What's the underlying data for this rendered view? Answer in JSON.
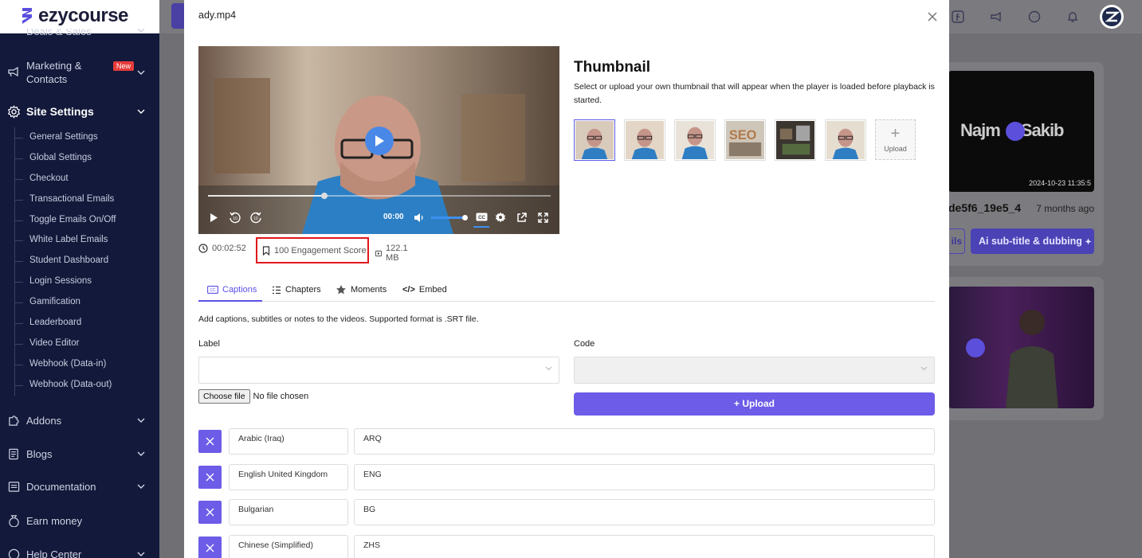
{
  "brand": {
    "name": "ezycourse"
  },
  "sidebar": {
    "partial_top": "Deals & Sales",
    "marketing": {
      "label_line1": "Marketing &",
      "label_line2": "Contacts",
      "badge": "New"
    },
    "site_settings": "Site Settings",
    "sub_items": [
      "General Settings",
      "Global Settings",
      "Checkout",
      "Transactional Emails",
      "Toggle Emails On/Off",
      "White Label Emails",
      "Student Dashboard",
      "Login Sessions",
      "Gamification",
      "Leaderboard",
      "Video Editor",
      "Webhook (Data-in)",
      "Webhook (Data-out)"
    ],
    "addons": "Addons",
    "blogs": "Blogs",
    "documentation": "Documentation",
    "earn_money": "Earn money",
    "help_center": "Help Center"
  },
  "background_cards": {
    "card1": {
      "watermark_left": "Najm",
      "watermark_right": "Sakib",
      "date": "2024-10-23 11:35:5",
      "title": "de5f6_19e5_4",
      "time": "7 months ago",
      "btn_left": "ils",
      "btn_right": "Ai sub-title & dubbing"
    }
  },
  "modal": {
    "title": "ady.mp4",
    "player": {
      "current_time": "00:00",
      "progress": 0.34,
      "volume": 0.95
    },
    "meta": {
      "duration": "00:02:52",
      "engagement": "100 Engagement Score",
      "size": "122.1 MB"
    },
    "thumbnail": {
      "heading": "Thumbnail",
      "description": "Select or upload your own thumbnail that will appear when the player is loaded before playback is started.",
      "upload_label": "Upload",
      "selected_index": 0
    },
    "tabs": {
      "captions": "Captions",
      "chapters": "Chapters",
      "moments": "Moments",
      "embed": "Embed"
    },
    "captions": {
      "help_text": "Add captions, subtitles or notes to the videos. Supported format is .SRT file.",
      "label_field": "Label",
      "code_field": "Code",
      "choose_file": "Choose file",
      "no_file": "No file chosen",
      "upload_button": "+ Upload",
      "rows": [
        {
          "language": "Arabic (Iraq)",
          "code": "ARQ"
        },
        {
          "language": "English United Kingdom",
          "code": "ENG"
        },
        {
          "language": "Bulgarian",
          "code": "BG"
        },
        {
          "language": "Chinese (Simplified)",
          "code": "ZHS"
        }
      ]
    }
  },
  "colors": {
    "accent": "#6c5ce7",
    "sidebar_bg": "#12193a",
    "highlight_box": "#e2161b",
    "player_play": "#4a88e8"
  }
}
